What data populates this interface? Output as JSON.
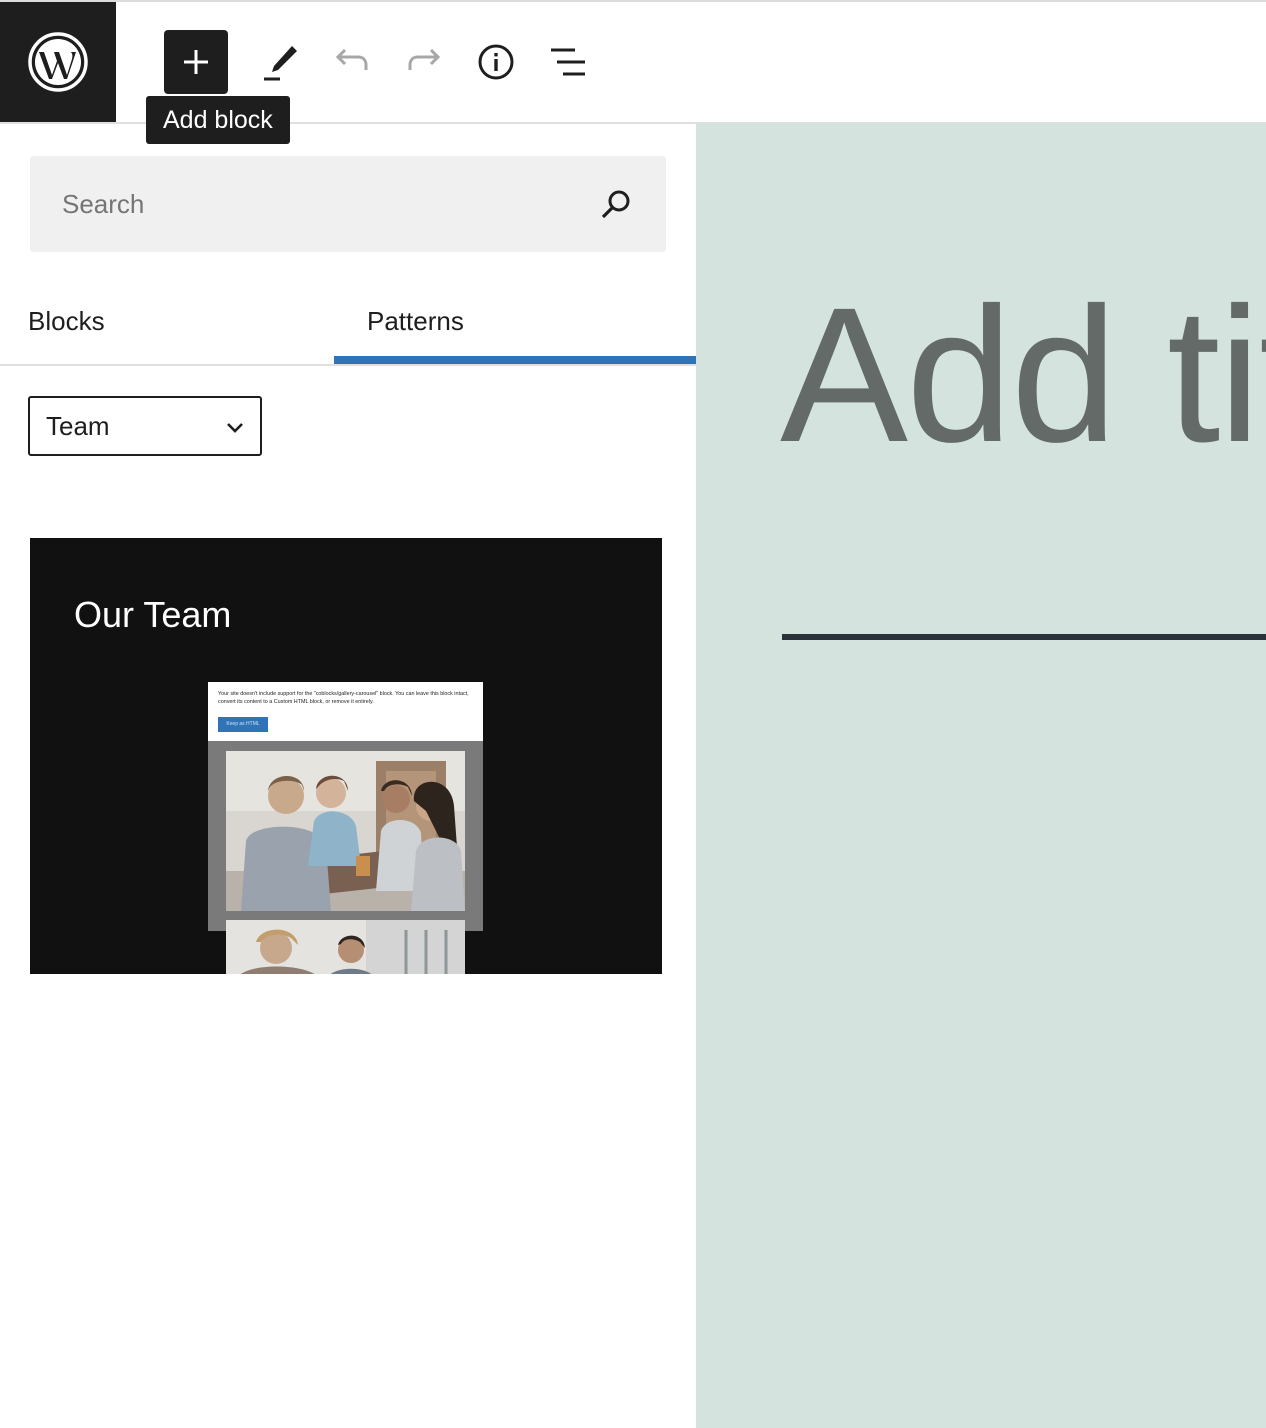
{
  "toolbar": {
    "tooltip": "Add block",
    "icons": {
      "logo": "wordpress-logo",
      "add": "plus-icon",
      "edit": "pencil-icon",
      "undo": "undo-icon",
      "redo": "redo-icon",
      "info": "info-icon",
      "outline": "list-view-icon"
    }
  },
  "inserter": {
    "search": {
      "placeholder": "Search",
      "value": ""
    },
    "tabs": [
      {
        "label": "Blocks",
        "active": false
      },
      {
        "label": "Patterns",
        "active": true
      }
    ],
    "category": {
      "selected": "Team"
    },
    "pattern": {
      "title": "Our Team",
      "notice": "Your site doesn't include support for the \"coblocks/gallery-carousel\" block. You can leave this block intact, convert its content to a Custom HTML block, or remove it entirely.",
      "notice_button": "Keep as HTML"
    }
  },
  "editor": {
    "title_placeholder": "Add title"
  },
  "colors": {
    "accent": "#3073b6",
    "dark": "#1e1e1e",
    "canvas_bg": "#d4e3dd",
    "pattern_bg": "#111111"
  }
}
